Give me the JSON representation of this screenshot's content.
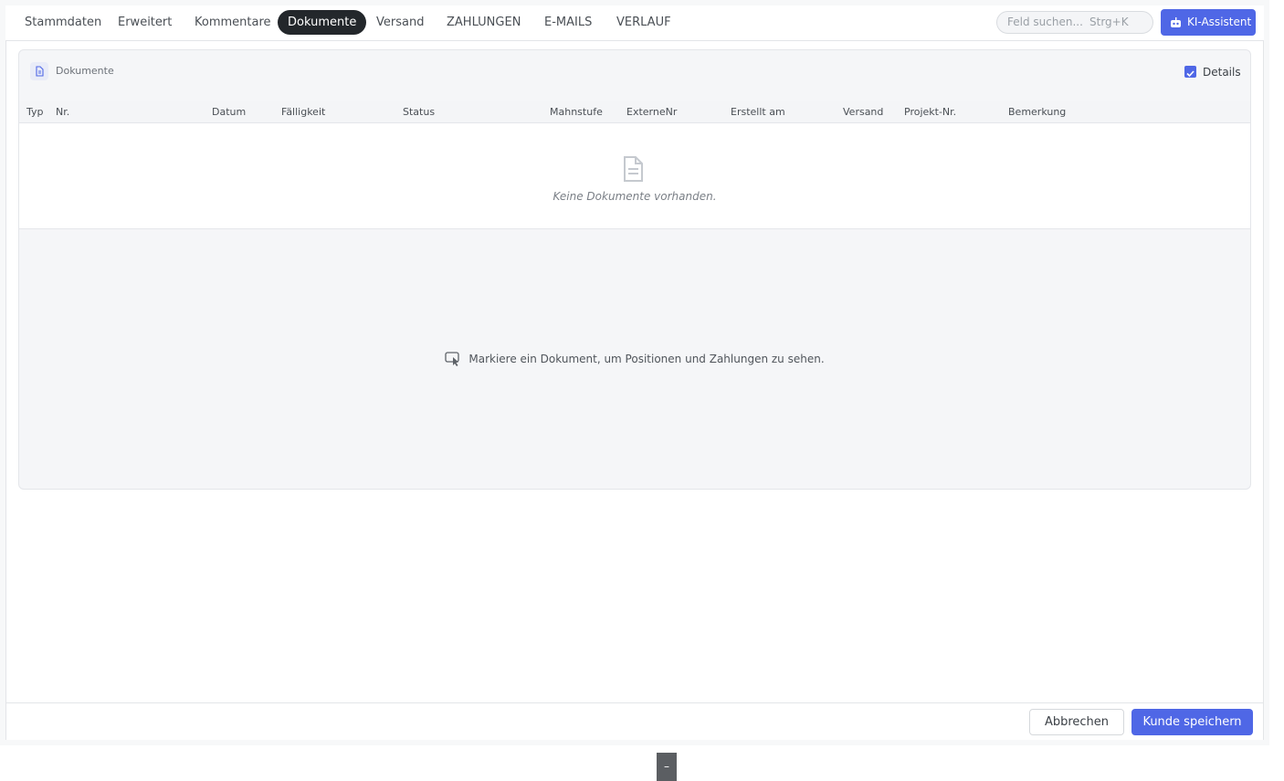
{
  "tabs": [
    {
      "label": "Stammdaten"
    },
    {
      "label": "Erweitert"
    },
    {
      "label": "Kommentare"
    },
    {
      "label": "Dokumente",
      "active": true
    },
    {
      "label": "Versand"
    },
    {
      "label": "ZAHLUNGEN"
    },
    {
      "label": "E-MAILS"
    },
    {
      "label": "VERLAUF"
    }
  ],
  "search": {
    "placeholder": "Feld suchen...",
    "shortcut": "Strg+K"
  },
  "ki_button": {
    "label": "KI-Assistent",
    "icon": "robot-icon"
  },
  "card": {
    "title": "Dokumente",
    "title_icon": "document-icon",
    "details_checkbox": {
      "label": "Details",
      "checked": true
    }
  },
  "table": {
    "columns": [
      "Typ",
      "Nr.",
      "Datum",
      "Fälligkeit",
      "Status",
      "Mahnstufe",
      "ExterneNr",
      "Erstellt am",
      "Versand",
      "Projekt-Nr.",
      "Bemerkung"
    ],
    "empty_text": "Keine Dokumente vorhanden.",
    "empty_icon": "document-icon"
  },
  "hint": {
    "text": "Markiere ein Dokument, um Positionen und Zahlungen zu sehen.",
    "icon": "cursor-click-icon"
  },
  "footer": {
    "cancel_label": "Abbrechen",
    "save_label": "Kunde speichern"
  },
  "minimize": {
    "label": "–"
  },
  "colors": {
    "accent": "#4f67e6",
    "active_tab": "#23272b"
  }
}
